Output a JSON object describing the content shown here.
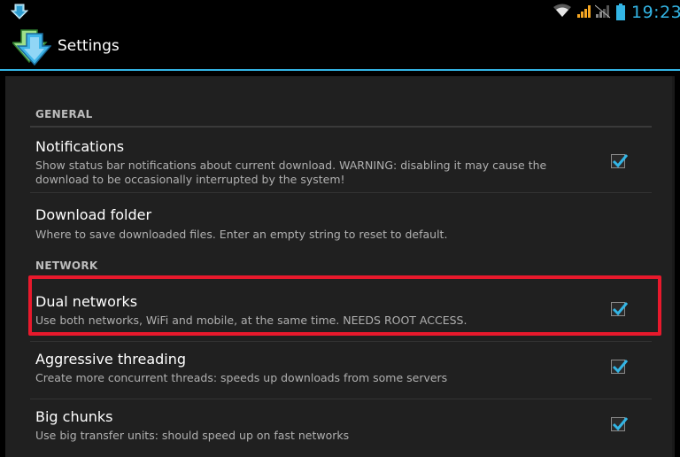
{
  "status_bar": {
    "notification_icon": "download-arrow-icon",
    "time": "19:23",
    "accent_color": "#33b5e5"
  },
  "action_bar": {
    "title": "Settings",
    "app_icon": "download-arrow-icon"
  },
  "categories": {
    "general": "GENERAL",
    "network": "NETWORK"
  },
  "prefs": {
    "notifications": {
      "title": "Notifications",
      "summary": "Show status bar notifications about current download. WARNING: disabling it may cause the download to be occasionally interrupted by the system!",
      "checked": true
    },
    "download_folder": {
      "title": "Download folder",
      "summary": "Where to save downloaded files. Enter an empty string to reset to default."
    },
    "dual_networks": {
      "title": "Dual networks",
      "summary": "Use both networks, WiFi and mobile, at the same time. NEEDS ROOT ACCESS.",
      "checked": true
    },
    "aggressive_threading": {
      "title": "Aggressive threading",
      "summary": "Create more concurrent threads: speeds up downloads from some servers",
      "checked": true
    },
    "big_chunks": {
      "title": "Big chunks",
      "summary": "Use big transfer units: should speed up on fast networks",
      "checked": true
    }
  },
  "highlight_color": "#e8192c"
}
